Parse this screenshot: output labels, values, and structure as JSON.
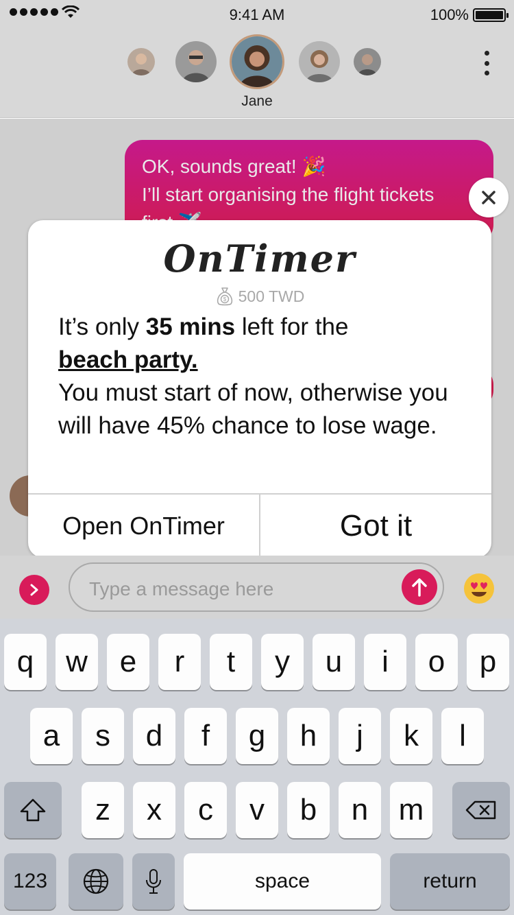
{
  "status_bar": {
    "time": "9:41 AM",
    "battery": "100%"
  },
  "header": {
    "active_contact": "Jane"
  },
  "chat": {
    "outgoing_lines": [
      "OK, sounds great! 🎉",
      "I’ll start organising the flight tickets",
      "first ✈️"
    ]
  },
  "popup": {
    "brand": "OnTimer",
    "wage": "500 TWD",
    "message": {
      "line1_prefix": "It’s only ",
      "time_left": "35 mins",
      "line1_suffix": " left for the",
      "event": "beach party.",
      "rest": "You must start of now, otherwise you will have 45% chance to lose wage."
    },
    "open_button": "Open OnTimer",
    "dismiss_button": "Got it"
  },
  "composer": {
    "placeholder": "Type a message here"
  },
  "keyboard": {
    "row1": [
      "q",
      "w",
      "e",
      "r",
      "t",
      "y",
      "u",
      "i",
      "o",
      "p"
    ],
    "row2": [
      "a",
      "s",
      "d",
      "f",
      "g",
      "h",
      "j",
      "k",
      "l"
    ],
    "row3": [
      "z",
      "x",
      "c",
      "v",
      "b",
      "n",
      "m"
    ],
    "numbers_key": "123",
    "space_key": "space",
    "return_key": "return"
  },
  "colors": {
    "accent": "#d81b5a",
    "bubble_top": "#c5198a",
    "bubble_bottom": "#cf1c4d"
  }
}
